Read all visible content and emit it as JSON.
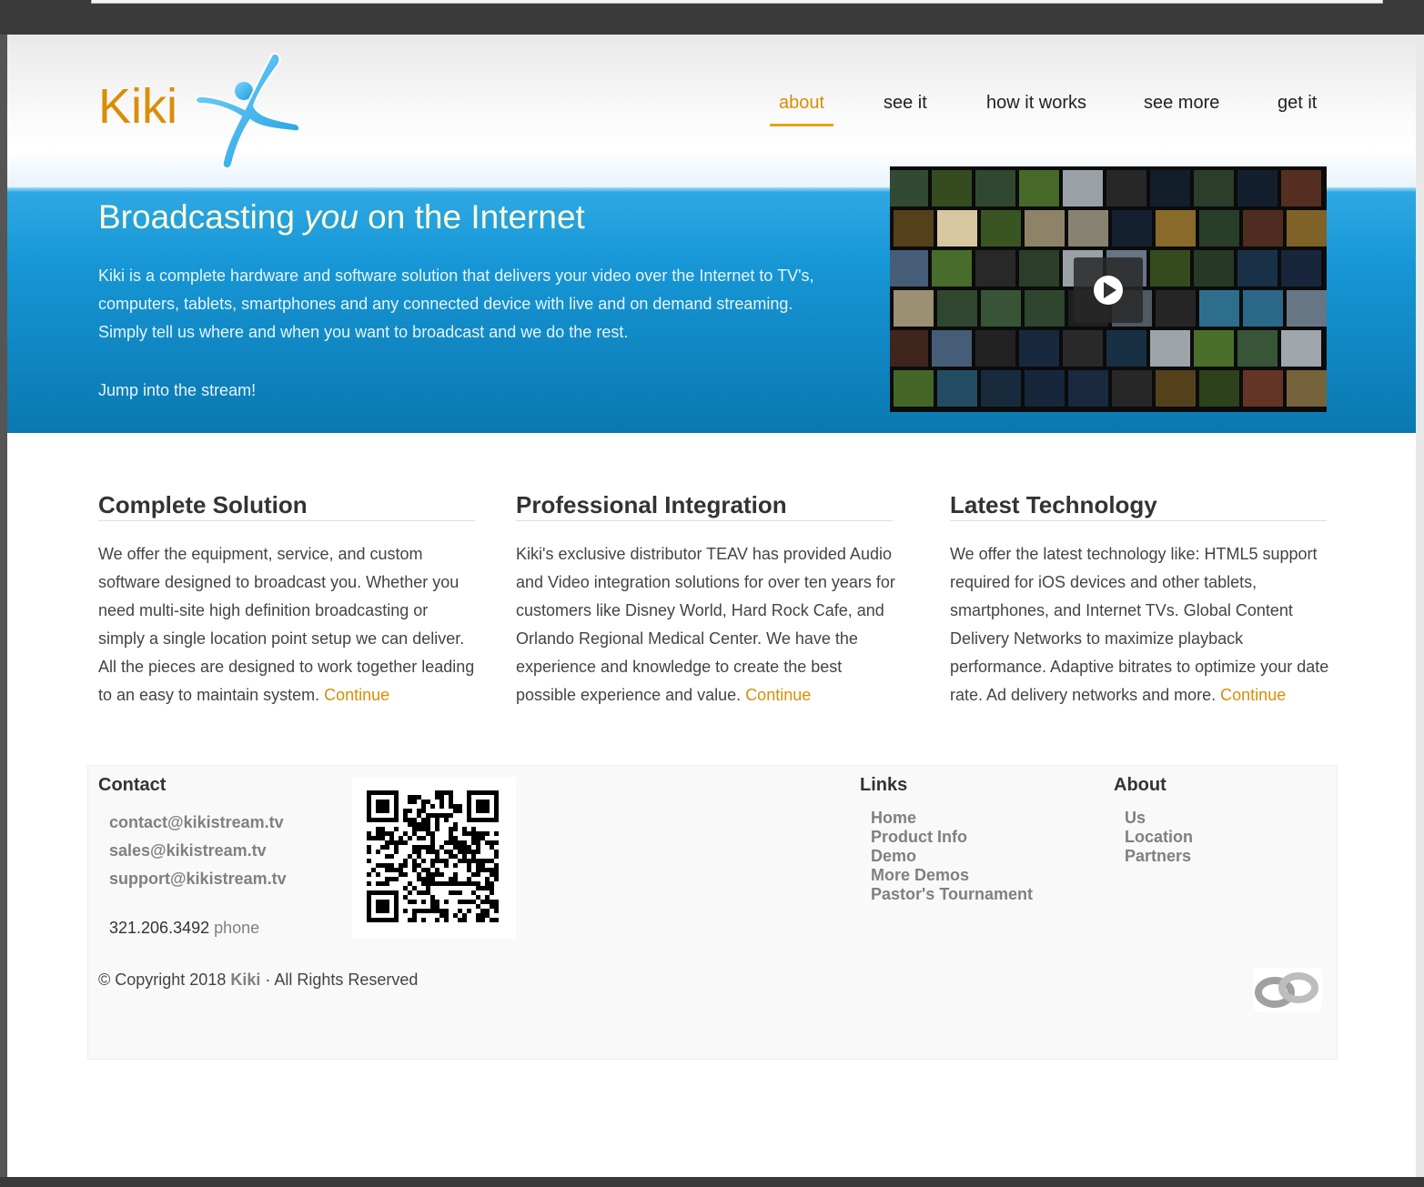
{
  "brand": {
    "name": "Kiki",
    "accent_color": "#d98e06",
    "blue": "#1797d6"
  },
  "nav": {
    "items": [
      {
        "label": "about",
        "active": true
      },
      {
        "label": "see it",
        "active": false
      },
      {
        "label": "how it works",
        "active": false
      },
      {
        "label": "see more",
        "active": false
      },
      {
        "label": "get it",
        "active": false
      }
    ]
  },
  "hero": {
    "title_pre": "Broadcasting ",
    "title_em": "you",
    "title_post": " on the Internet",
    "body": "Kiki is a complete hardware and software solution that delivers your video over the Internet to TV's, computers, tablets, smartphones and any connected device with live and on demand streaming. Simply tell us where and when you want to broadcast and we do the rest.",
    "jump": "Jump into the stream!",
    "video_icon": "play-icon"
  },
  "columns": [
    {
      "title": "Complete Solution",
      "text": "We offer the equipment, service, and custom software designed to broadcast you. Whether you need multi-site high definition broadcasting or simply a single location point setup we can deliver. All the pieces are designed to work together leading to an easy to maintain system.",
      "link": "Continue"
    },
    {
      "title": "Professional Integration",
      "text": "Kiki's exclusive distributor TEAV has provided Audio and Video integration solutions for over ten years for customers like Disney World, Hard Rock Cafe, and Orlando Regional Medical Center. We have the experience and knowledge to create the best possible experience and value.",
      "link": "Continue"
    },
    {
      "title": "Latest Technology",
      "text": "We offer the latest technology like: HTML5 support required for iOS devices and other tablets, smartphones, and Internet TVs. Global Content Delivery Networks to maximize playback performance. Adaptive bitrates to optimize your date rate. Ad delivery networks and more.",
      "link": "Continue"
    }
  ],
  "footer": {
    "contact": {
      "heading": "Contact",
      "emails": [
        "contact@kikistream.tv",
        "sales@kikistream.tv",
        "support@kikistream.tv"
      ],
      "phone": "321.206.3492",
      "phone_label": "phone"
    },
    "links": {
      "heading": "Links",
      "items": [
        "Home",
        "Product Info",
        "Demo",
        "More Demos",
        "Pastor's Tournament"
      ]
    },
    "about": {
      "heading": "About",
      "items": [
        "Us",
        "Location",
        "Partners"
      ]
    },
    "copyright_pre": "© Copyright 2018 ",
    "copyright_brand": "Kiki",
    "copyright_post": " · All Rights Reserved"
  }
}
